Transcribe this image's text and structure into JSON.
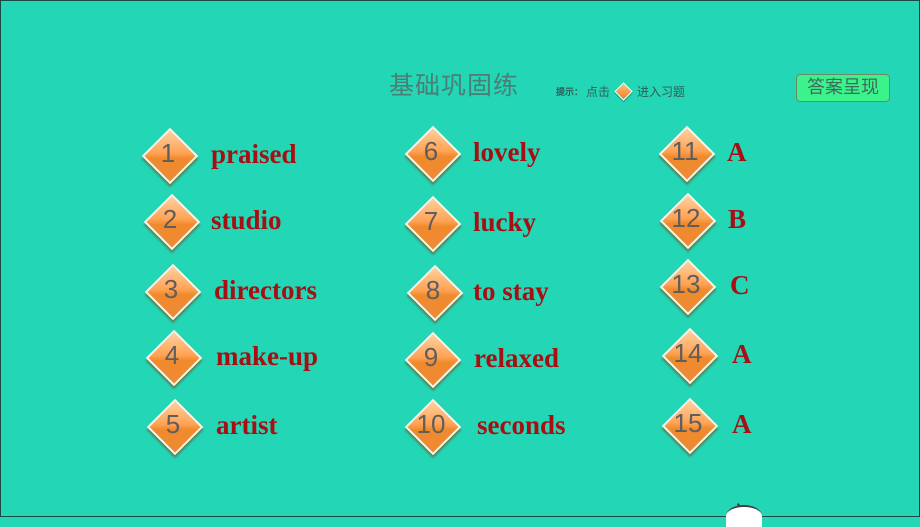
{
  "header": {
    "title": "基础巩固练",
    "hint_prefix": "提示：",
    "hint_click": "点击",
    "hint_suffix": "进入习题",
    "answer_button": "答案呈现"
  },
  "items": [
    {
      "num": "1",
      "answer": "praised"
    },
    {
      "num": "2",
      "answer": "studio"
    },
    {
      "num": "3",
      "answer": "directors"
    },
    {
      "num": "4",
      "answer": "make-up"
    },
    {
      "num": "5",
      "answer": "artist"
    },
    {
      "num": "6",
      "answer": "lovely"
    },
    {
      "num": "7",
      "answer": "lucky"
    },
    {
      "num": "8",
      "answer": "to stay"
    },
    {
      "num": "9",
      "answer": "relaxed"
    },
    {
      "num": "10",
      "answer": "seconds"
    },
    {
      "num": "11",
      "answer": "A"
    },
    {
      "num": "12",
      "answer": "B"
    },
    {
      "num": "13",
      "answer": "C"
    },
    {
      "num": "14",
      "answer": "A"
    },
    {
      "num": "15",
      "answer": "A"
    }
  ]
}
